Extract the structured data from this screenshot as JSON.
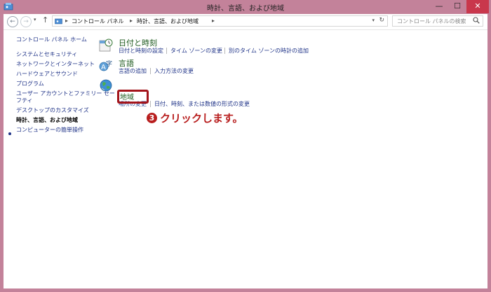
{
  "window": {
    "title": "時計、言語、および地域",
    "minimize": "—",
    "maximize": "☐",
    "close": "✕"
  },
  "nav": {
    "back": "←",
    "forward": "→",
    "history": "▾",
    "up": "↑"
  },
  "address": {
    "sep1": "▸",
    "crumb1": "コントロール パネル",
    "sep2": "▸",
    "crumb2": "時計、言語、および地域",
    "sep3": "▸",
    "dropdown": "▾",
    "refresh": "↻"
  },
  "search": {
    "placeholder": "コントロール パネルの検索"
  },
  "sidebar": {
    "home": "コントロール パネル ホーム",
    "items": [
      "システムとセキュリティ",
      "ネットワークとインターネット",
      "ハードウェアとサウンド",
      "プログラム",
      "ユーザー アカウントとファミリー セー",
      "フティ",
      "デスクトップのカスタマイズ",
      "時計、言語、および地域",
      "コンピューターの簡単操作"
    ]
  },
  "categories": {
    "datetime": {
      "title": "日付と時刻",
      "links": [
        "日付と時刻の設定",
        "タイム ゾーンの変更",
        "別のタイム ゾーンの時計の追加"
      ]
    },
    "language": {
      "title": "言語",
      "links": [
        "言語の追加",
        "入力方法の変更"
      ]
    },
    "region": {
      "title": "地域",
      "links": [
        "場所の変更",
        "日付、時刻、または数値の形式の変更"
      ]
    }
  },
  "annotation": {
    "number": "3",
    "text": "クリックします。"
  },
  "colors": {
    "frame": "#c3829a",
    "link": "#1e3287",
    "category_title": "#1e5a1e",
    "annotation": "#b81e1e",
    "close_button": "#c9374c"
  }
}
